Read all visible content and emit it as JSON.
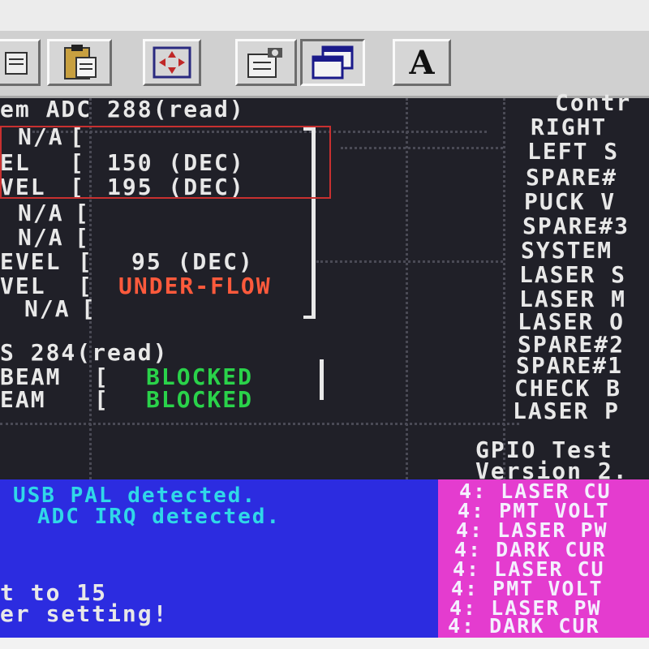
{
  "toolbar": {
    "buttons": [
      {
        "name": "doc-icon"
      },
      {
        "name": "clipboard-icon"
      },
      {
        "name": "move-arrows-icon"
      },
      {
        "name": "folder-camera-icon"
      },
      {
        "name": "windows-icon"
      },
      {
        "name": "font-icon",
        "glyph": "A"
      }
    ]
  },
  "adc": {
    "header": "em ADC 288(read)",
    "rows": [
      {
        "label": "N/A",
        "value": ""
      },
      {
        "label": "EL",
        "value": "150 (DEC)"
      },
      {
        "label": "VEL",
        "value": "195 (DEC)"
      },
      {
        "label": "N/A",
        "value": ""
      },
      {
        "label": "N/A",
        "value": ""
      },
      {
        "label": "EVEL",
        "value": "95 (DEC)"
      },
      {
        "label": "VEL",
        "value": "UNDER-FLOW"
      },
      {
        "label": "N/A",
        "value": ""
      }
    ]
  },
  "beam": {
    "header": "S 284(read)",
    "rows": [
      {
        "label": "BEAM",
        "value": "BLOCKED"
      },
      {
        "label": "EAM",
        "value": "BLOCKED"
      }
    ]
  },
  "control": {
    "header": "Contr",
    "items": [
      "RIGHT",
      "LEFT S",
      "SPARE#",
      "PUCK V",
      "SPARE#3",
      "SYSTEM",
      "LASER S",
      "LASER M",
      "LASER O",
      "SPARE#2",
      "SPARE#1",
      "CHECK B",
      "LASER P"
    ]
  },
  "gpio": {
    "title": "GPIO Test",
    "version": "Version 2."
  },
  "messages": {
    "line1": "USB PAL detected.",
    "line2": "ADC IRQ detected.",
    "line3": "t to 15",
    "line4": "er setting!"
  },
  "menu": {
    "items": [
      {
        "key": "4:",
        "label": "LASER CU"
      },
      {
        "key": "4:",
        "label": "PMT VOLT"
      },
      {
        "key": "4:",
        "label": "LASER PW"
      },
      {
        "key": "4:",
        "label": "DARK CUR"
      },
      {
        "key": "4:",
        "label": "LASER CU"
      },
      {
        "key": "4:",
        "label": "PMT VOLT"
      },
      {
        "key": "4:",
        "label": "LASER PW"
      },
      {
        "key": "4:",
        "label": "DARK CUR"
      }
    ]
  },
  "colors": {
    "screen_bg": "#202028",
    "text": "#e8e8e8",
    "underflow": "#ff5a3c",
    "blocked": "#2ad24a",
    "blue_panel": "#2c2ce0",
    "magenta_panel": "#e43ccf",
    "cyan_text": "#30d8e8"
  }
}
